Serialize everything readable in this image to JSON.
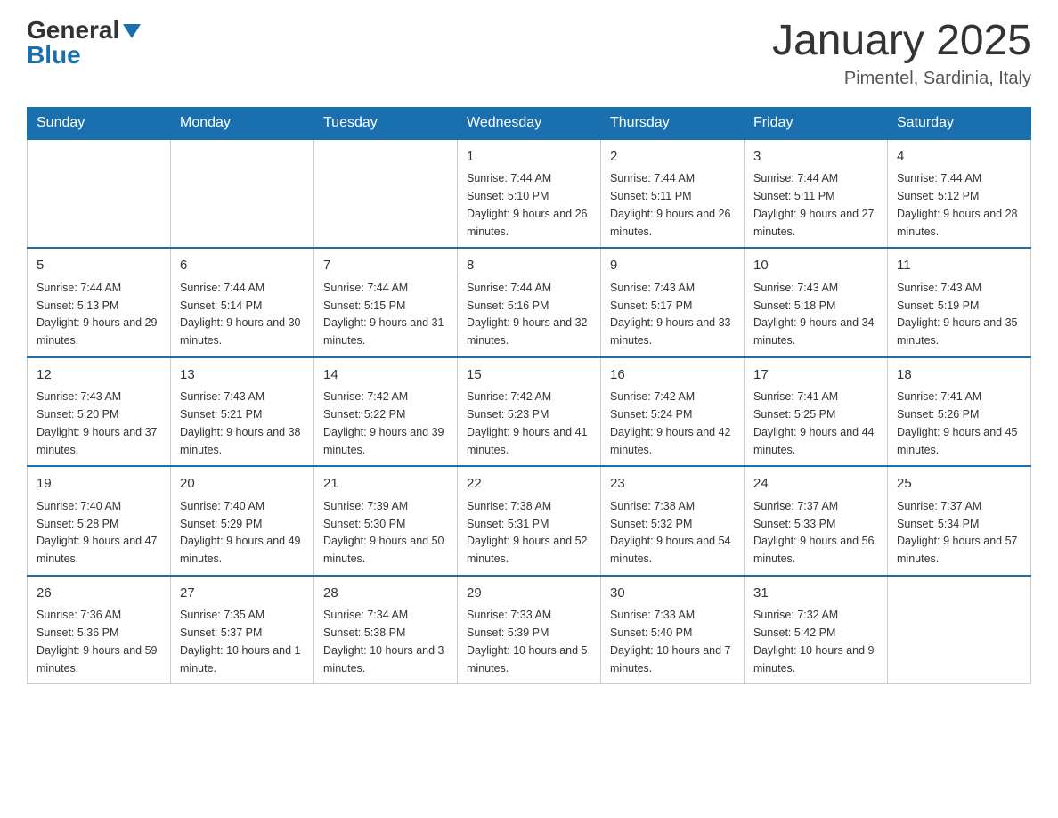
{
  "logo": {
    "general": "General",
    "blue": "Blue"
  },
  "title": "January 2025",
  "location": "Pimentel, Sardinia, Italy",
  "days_of_week": [
    "Sunday",
    "Monday",
    "Tuesday",
    "Wednesday",
    "Thursday",
    "Friday",
    "Saturday"
  ],
  "weeks": [
    [
      {
        "day": "",
        "info": ""
      },
      {
        "day": "",
        "info": ""
      },
      {
        "day": "",
        "info": ""
      },
      {
        "day": "1",
        "info": "Sunrise: 7:44 AM\nSunset: 5:10 PM\nDaylight: 9 hours and 26 minutes."
      },
      {
        "day": "2",
        "info": "Sunrise: 7:44 AM\nSunset: 5:11 PM\nDaylight: 9 hours and 26 minutes."
      },
      {
        "day": "3",
        "info": "Sunrise: 7:44 AM\nSunset: 5:11 PM\nDaylight: 9 hours and 27 minutes."
      },
      {
        "day": "4",
        "info": "Sunrise: 7:44 AM\nSunset: 5:12 PM\nDaylight: 9 hours and 28 minutes."
      }
    ],
    [
      {
        "day": "5",
        "info": "Sunrise: 7:44 AM\nSunset: 5:13 PM\nDaylight: 9 hours and 29 minutes."
      },
      {
        "day": "6",
        "info": "Sunrise: 7:44 AM\nSunset: 5:14 PM\nDaylight: 9 hours and 30 minutes."
      },
      {
        "day": "7",
        "info": "Sunrise: 7:44 AM\nSunset: 5:15 PM\nDaylight: 9 hours and 31 minutes."
      },
      {
        "day": "8",
        "info": "Sunrise: 7:44 AM\nSunset: 5:16 PM\nDaylight: 9 hours and 32 minutes."
      },
      {
        "day": "9",
        "info": "Sunrise: 7:43 AM\nSunset: 5:17 PM\nDaylight: 9 hours and 33 minutes."
      },
      {
        "day": "10",
        "info": "Sunrise: 7:43 AM\nSunset: 5:18 PM\nDaylight: 9 hours and 34 minutes."
      },
      {
        "day": "11",
        "info": "Sunrise: 7:43 AM\nSunset: 5:19 PM\nDaylight: 9 hours and 35 minutes."
      }
    ],
    [
      {
        "day": "12",
        "info": "Sunrise: 7:43 AM\nSunset: 5:20 PM\nDaylight: 9 hours and 37 minutes."
      },
      {
        "day": "13",
        "info": "Sunrise: 7:43 AM\nSunset: 5:21 PM\nDaylight: 9 hours and 38 minutes."
      },
      {
        "day": "14",
        "info": "Sunrise: 7:42 AM\nSunset: 5:22 PM\nDaylight: 9 hours and 39 minutes."
      },
      {
        "day": "15",
        "info": "Sunrise: 7:42 AM\nSunset: 5:23 PM\nDaylight: 9 hours and 41 minutes."
      },
      {
        "day": "16",
        "info": "Sunrise: 7:42 AM\nSunset: 5:24 PM\nDaylight: 9 hours and 42 minutes."
      },
      {
        "day": "17",
        "info": "Sunrise: 7:41 AM\nSunset: 5:25 PM\nDaylight: 9 hours and 44 minutes."
      },
      {
        "day": "18",
        "info": "Sunrise: 7:41 AM\nSunset: 5:26 PM\nDaylight: 9 hours and 45 minutes."
      }
    ],
    [
      {
        "day": "19",
        "info": "Sunrise: 7:40 AM\nSunset: 5:28 PM\nDaylight: 9 hours and 47 minutes."
      },
      {
        "day": "20",
        "info": "Sunrise: 7:40 AM\nSunset: 5:29 PM\nDaylight: 9 hours and 49 minutes."
      },
      {
        "day": "21",
        "info": "Sunrise: 7:39 AM\nSunset: 5:30 PM\nDaylight: 9 hours and 50 minutes."
      },
      {
        "day": "22",
        "info": "Sunrise: 7:38 AM\nSunset: 5:31 PM\nDaylight: 9 hours and 52 minutes."
      },
      {
        "day": "23",
        "info": "Sunrise: 7:38 AM\nSunset: 5:32 PM\nDaylight: 9 hours and 54 minutes."
      },
      {
        "day": "24",
        "info": "Sunrise: 7:37 AM\nSunset: 5:33 PM\nDaylight: 9 hours and 56 minutes."
      },
      {
        "day": "25",
        "info": "Sunrise: 7:37 AM\nSunset: 5:34 PM\nDaylight: 9 hours and 57 minutes."
      }
    ],
    [
      {
        "day": "26",
        "info": "Sunrise: 7:36 AM\nSunset: 5:36 PM\nDaylight: 9 hours and 59 minutes."
      },
      {
        "day": "27",
        "info": "Sunrise: 7:35 AM\nSunset: 5:37 PM\nDaylight: 10 hours and 1 minute."
      },
      {
        "day": "28",
        "info": "Sunrise: 7:34 AM\nSunset: 5:38 PM\nDaylight: 10 hours and 3 minutes."
      },
      {
        "day": "29",
        "info": "Sunrise: 7:33 AM\nSunset: 5:39 PM\nDaylight: 10 hours and 5 minutes."
      },
      {
        "day": "30",
        "info": "Sunrise: 7:33 AM\nSunset: 5:40 PM\nDaylight: 10 hours and 7 minutes."
      },
      {
        "day": "31",
        "info": "Sunrise: 7:32 AM\nSunset: 5:42 PM\nDaylight: 10 hours and 9 minutes."
      },
      {
        "day": "",
        "info": ""
      }
    ]
  ]
}
